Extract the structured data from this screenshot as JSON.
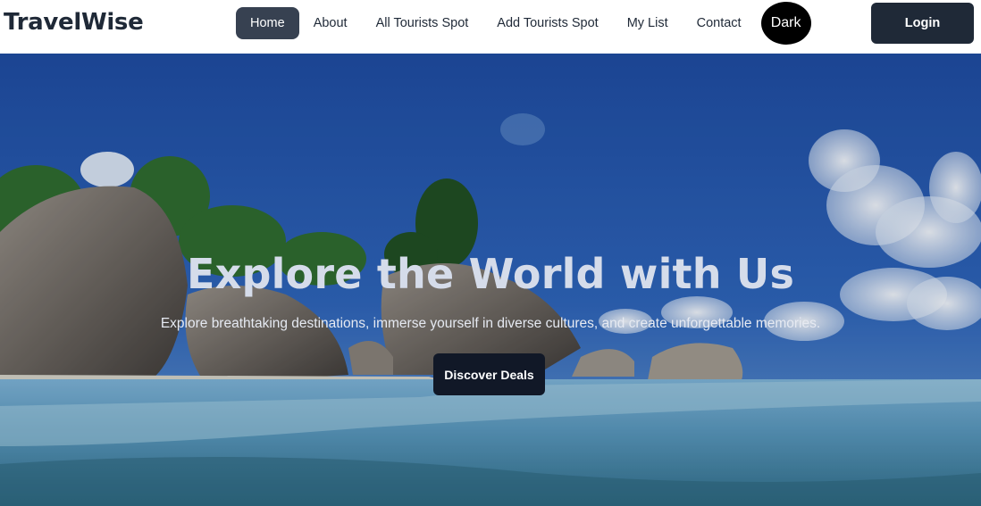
{
  "brand": {
    "name": "TravelWise"
  },
  "nav": {
    "items": [
      {
        "label": "Home",
        "active": true
      },
      {
        "label": "About"
      },
      {
        "label": "All Tourists Spot"
      },
      {
        "label": "Add Tourists Spot"
      },
      {
        "label": "My List"
      },
      {
        "label": "Contact"
      }
    ],
    "theme_toggle_label": "Dark",
    "login_label": "Login"
  },
  "hero": {
    "title": "Explore the World with Us",
    "subtitle": "Explore breathtaking destinations, immerse yourself in diverse cultures, and create unforgettable memories.",
    "cta_label": "Discover Deals"
  },
  "colors": {
    "nav_active_bg": "#374151",
    "button_dark": "#1f2937",
    "toggle_bg": "#000000",
    "sky_top": "#1b4aa0",
    "sea": "#5aa0c8"
  },
  "icons": {
    "hero_image": "tropical-beach-background"
  }
}
